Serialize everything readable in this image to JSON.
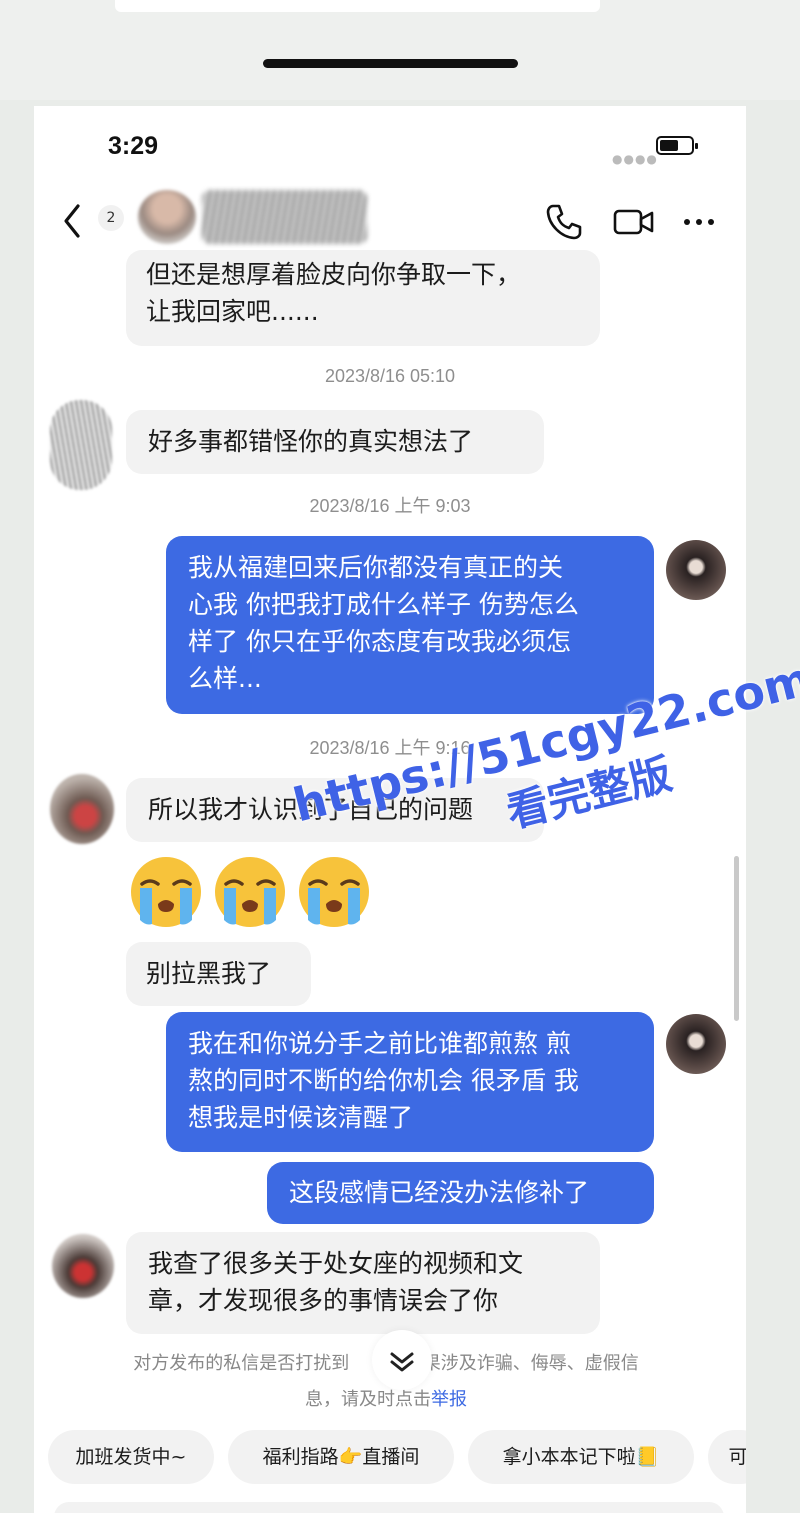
{
  "status": {
    "time": "3:29"
  },
  "header": {
    "unread_count": "2"
  },
  "messages": [
    {
      "text": "但还是想厚着脸皮向你争取一下，\n让我回家吧......"
    },
    {
      "timestamp": "2023/8/16 05:10"
    },
    {
      "text": "好多事都错怪你的真实想法了"
    },
    {
      "timestamp": "2023/8/16 上午 9:03"
    },
    {
      "text": "我从福建回来后你都没有真正的关\n心我 你把我打成什么样子 伤势怎么\n样了 你只在乎你态度有改我必须怎\n么样..."
    },
    {
      "timestamp": "2023/8/16 上午 9:16"
    },
    {
      "text": "所以我才认识到了自己的问题"
    },
    {
      "text": "别拉黑我了"
    },
    {
      "text": "我在和你说分手之前比谁都煎熬 煎\n熬的同时不断的给你机会 很矛盾 我\n想我是时候该清醒了"
    },
    {
      "text": "这段感情已经没办法修补了"
    },
    {
      "text": "我查了很多关于处女座的视频和文\n章，才发现很多的事情误会了你"
    }
  ],
  "notice": {
    "line1_left": "对方发布的私信是否打扰到",
    "line1_right": "果涉及诈骗、侮辱、虚假信",
    "line2": "息，请及时点击",
    "report_link": "举报"
  },
  "quick_replies": [
    "加班发货中~",
    "福利指路👉直播间",
    "拿小本本记下啦📒",
    "可"
  ],
  "watermark": {
    "url": "https://51cgy22.com",
    "sub": "看完整版"
  }
}
